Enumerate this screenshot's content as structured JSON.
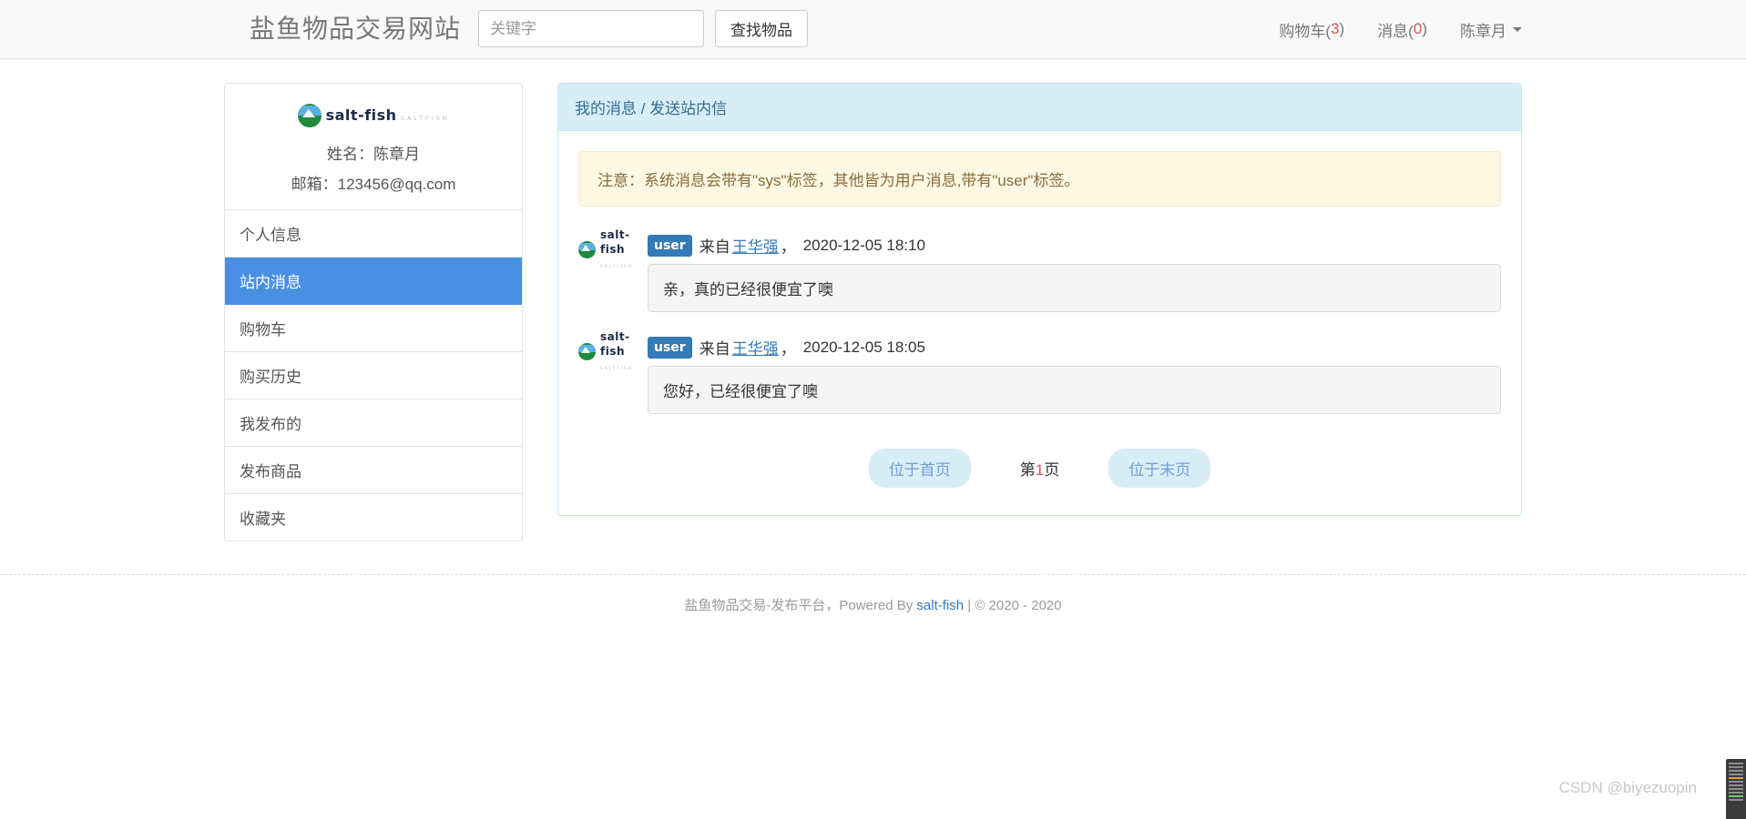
{
  "navbar": {
    "brand": "盐鱼物品交易网站",
    "search": {
      "placeholder": "关键字",
      "value": "",
      "button_label": "查找物品"
    },
    "links": [
      {
        "label": "购物车(",
        "count": "3",
        "suffix": ")"
      },
      {
        "label": "消息(",
        "count": "0",
        "suffix": ")"
      }
    ],
    "cart_prefix": "购物车(",
    "cart_count": "3",
    "cart_suffix": ")",
    "message_prefix": "消息(",
    "message_count": "0",
    "message_suffix": ")",
    "user_name": "陈章月"
  },
  "sidebar": {
    "logo": {
      "name": "salt-fish",
      "sub": "SALTFISH"
    },
    "profile": {
      "name_line": "姓名：陈章月",
      "email_line": "邮箱：123456@qq.com"
    },
    "items": [
      {
        "label": "个人信息",
        "active": false
      },
      {
        "label": "站内消息",
        "active": true
      },
      {
        "label": "购物车",
        "active": false
      },
      {
        "label": "购买历史",
        "active": false
      },
      {
        "label": "我发布的",
        "active": false
      },
      {
        "label": "发布商品",
        "active": false
      },
      {
        "label": "收藏夹",
        "active": false
      }
    ]
  },
  "main": {
    "panel_title": "我的消息 / 发送站内信",
    "notice": "注意：系统消息会带有\"sys\"标签，其他皆为用户消息,带有\"user\"标签。",
    "messages": [
      {
        "tag": "user",
        "from_label": "来自",
        "sender": "王华强",
        "comma": "，",
        "time": "2020-12-05 18:10",
        "body": "亲，真的已经很便宜了噢"
      },
      {
        "tag": "user",
        "from_label": "来自",
        "sender": "王华强",
        "comma": "，",
        "time": "2020-12-05 18:05",
        "body": "您好，已经很便宜了噢"
      }
    ],
    "pagination": {
      "first_label": "位于首页",
      "page_prefix": "第",
      "page_number": "1",
      "page_suffix": "页",
      "last_label": "位于末页"
    }
  },
  "footer": {
    "text_before": "盐鱼物品交易-发布平台，Powered By ",
    "link": "salt-fish",
    "text_after": " | © 2020 - 2020"
  },
  "watermark": "CSDN @biyezuopin",
  "colors": {
    "accent_blue": "#4a90e2",
    "panel_blue": "#d9edf7",
    "panel_border": "#bce8f1",
    "badge_blue": "#337ab7",
    "alert_bg": "#fcf8e3",
    "alert_border": "#faebcc",
    "alert_text": "#8a6d3b",
    "red": "#d9534f",
    "navbar_bg": "#f8f8f8"
  }
}
